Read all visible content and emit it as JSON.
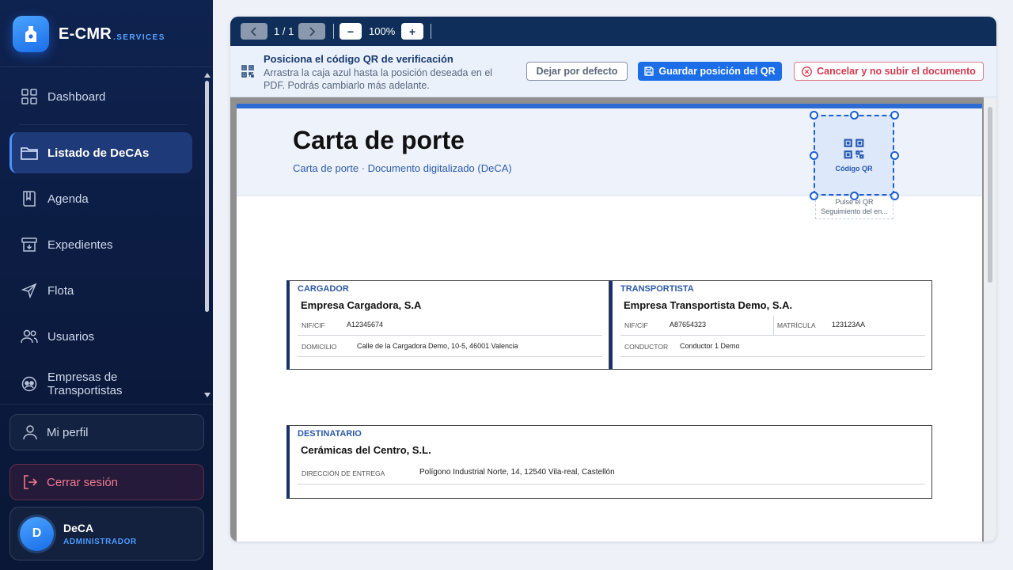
{
  "brand": {
    "name": "E-CMR",
    "suffix": ".SERVICES"
  },
  "sidebar": {
    "items": [
      {
        "label": "Dashboard",
        "icon": "grid-icon"
      },
      {
        "label": "Listado de DeCAs",
        "icon": "folder-icon",
        "active": true
      },
      {
        "label": "Agenda",
        "icon": "book-icon"
      },
      {
        "label": "Expedientes",
        "icon": "archive-icon"
      },
      {
        "label": "Flota",
        "icon": "send-icon"
      },
      {
        "label": "Usuarios",
        "icon": "users-icon"
      },
      {
        "label": "Empresas de Transportistas",
        "icon": "companies-icon"
      }
    ],
    "profile_label": "Mi perfil",
    "logout_label": "Cerrar sesión",
    "user": {
      "initial": "D",
      "name": "DeCA",
      "role": "ADMINISTRADOR"
    }
  },
  "toolbar": {
    "page": "1 / 1",
    "zoom": "100%",
    "minus": "−",
    "plus": "+"
  },
  "qr_bar": {
    "title": "Posiciona el código QR de verificación",
    "description": "Arrastra la caja azul hasta la posición deseada en el PDF. Podrás cambiarlo más adelante.",
    "default_label": "Dejar por defecto",
    "save_label": "Guardar posición del QR",
    "cancel_label": "Cancelar y no subir el documento"
  },
  "document": {
    "title": "Carta de porte",
    "subtitle": "Carta de porte · Documento digitalizado (DeCA)",
    "qr": {
      "label": "Código QR",
      "caption_line1": "Pulse el QR",
      "caption_line2": "Seguimiento del en..."
    },
    "cargador": {
      "type": "CARGADOR",
      "name": "Empresa Cargadora, S.A",
      "nif_label": "NIF/CIF",
      "nif": "A12345674",
      "domicilio_label": "DOMICILIO",
      "domicilio": "Calle de la Cargadora Demo, 10-5, 46001 Valencia"
    },
    "transportista": {
      "type": "TRANSPORTISTA",
      "name": "Empresa Transportista Demo, S.A.",
      "nif_label": "NIF/CIF",
      "nif": "A87654323",
      "matricula_label": "MATRÍCULA",
      "matricula": "123123AA",
      "conductor_label": "CONDUCTOR",
      "conductor": "Conductor 1 Demo"
    },
    "destinatario": {
      "type": "DESTINATARIO",
      "name": "Cerámicas del Centro, S.L.",
      "direccion_label": "DIRECCIÓN DE ENTREGA",
      "direccion": "Polígono Industrial Norte, 14, 12540 Vila-real, Castellón"
    }
  },
  "colors": {
    "sidebar_bg": "#0f2350",
    "accent": "#1b6ee8",
    "toolbar_bg": "#0f2f5a",
    "danger": "#d3384f"
  }
}
